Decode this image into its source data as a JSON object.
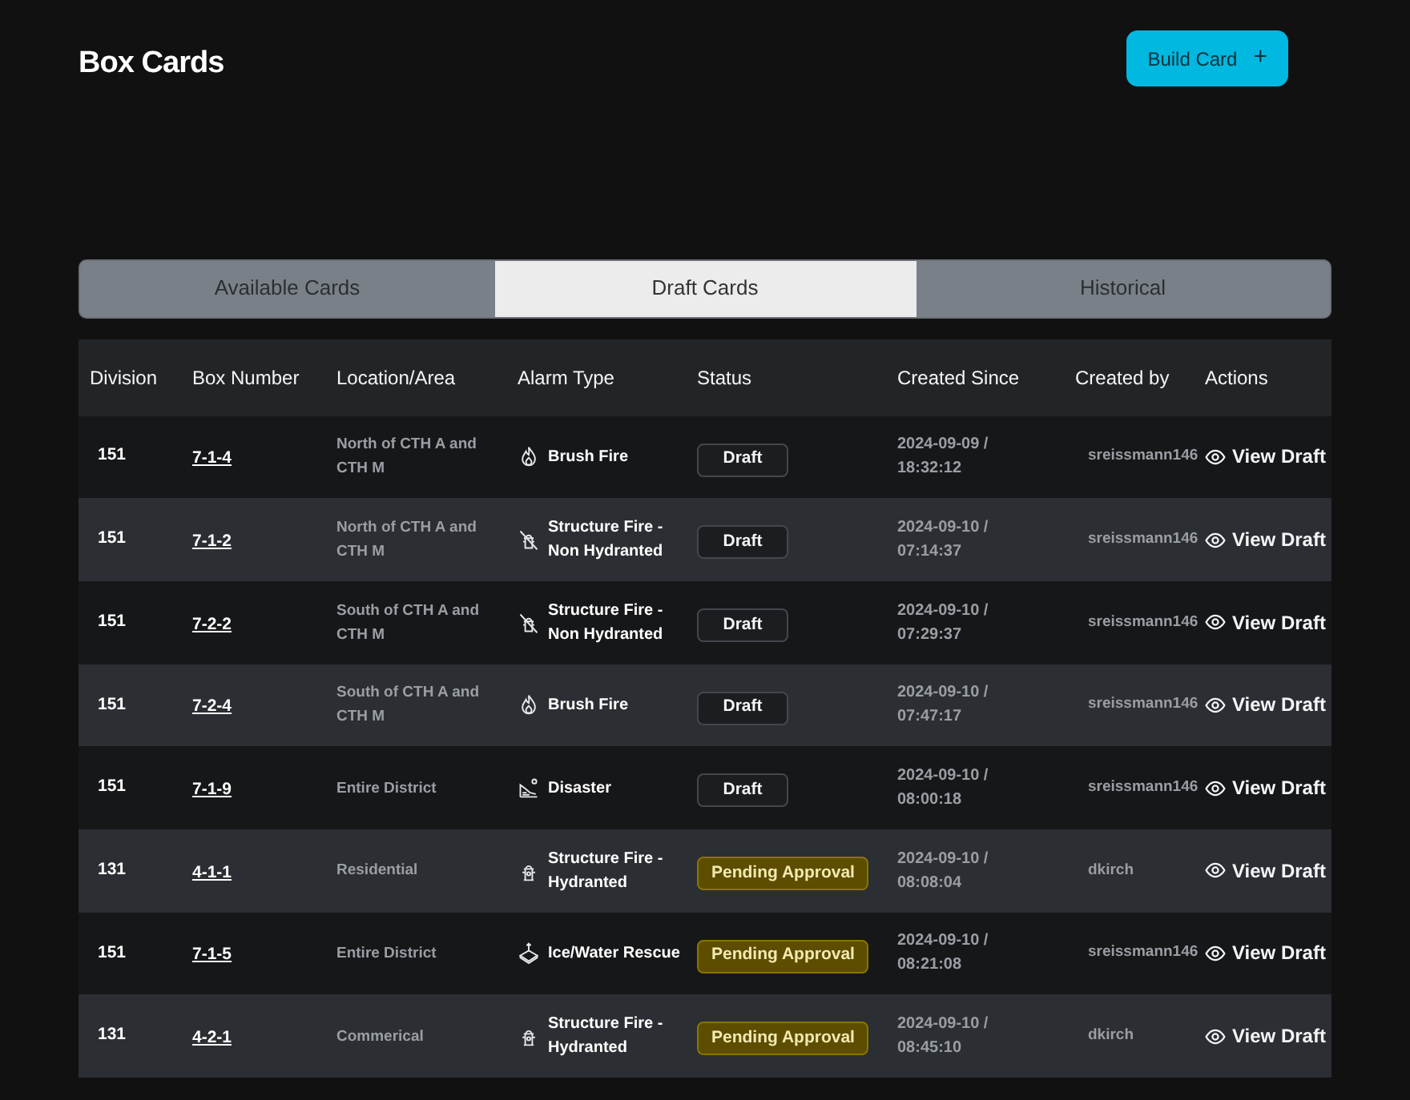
{
  "page": {
    "title": "Box Cards",
    "build_button": "Build Card",
    "build_icon": "+"
  },
  "tabs": [
    {
      "label": "Available Cards",
      "selected": false
    },
    {
      "label": "Draft Cards",
      "selected": true
    },
    {
      "label": "Historical",
      "selected": false
    }
  ],
  "table": {
    "columns": [
      "Division",
      "Box Number",
      "Location/Area",
      "Alarm Type",
      "Status",
      "Created Since",
      "Created by",
      "Actions"
    ],
    "rows": [
      {
        "division": "151",
        "box_number": "7-1-4",
        "location": "North of CTH A and CTH M",
        "alarm": {
          "kind": "brush",
          "label": "Brush Fire"
        },
        "status": {
          "kind": "draft",
          "label": "Draft"
        },
        "created_since": "2024-09-09 / 18:32:12",
        "created_by": "sreissmann146",
        "action": "View Draft"
      },
      {
        "division": "151",
        "box_number": "7-1-2",
        "location": "North of CTH A and CTH M",
        "alarm": {
          "kind": "nohydrant",
          "label": "Structure Fire - Non Hydranted"
        },
        "status": {
          "kind": "draft",
          "label": "Draft"
        },
        "created_since": "2024-09-10 / 07:14:37",
        "created_by": "sreissmann146",
        "action": "View Draft"
      },
      {
        "division": "151",
        "box_number": "7-2-2",
        "location": "South of CTH A and CTH M",
        "alarm": {
          "kind": "nohydrant",
          "label": "Structure Fire - Non Hydranted"
        },
        "status": {
          "kind": "draft",
          "label": "Draft"
        },
        "created_since": "2024-09-10 / 07:29:37",
        "created_by": "sreissmann146",
        "action": "View Draft"
      },
      {
        "division": "151",
        "box_number": "7-2-4",
        "location": "South of CTH A and CTH M",
        "alarm": {
          "kind": "brush",
          "label": "Brush Fire"
        },
        "status": {
          "kind": "draft",
          "label": "Draft"
        },
        "created_since": "2024-09-10 / 07:47:17",
        "created_by": "sreissmann146",
        "action": "View Draft"
      },
      {
        "division": "151",
        "box_number": "7-1-9",
        "location": "Entire District",
        "alarm": {
          "kind": "disaster",
          "label": "Disaster"
        },
        "status": {
          "kind": "draft",
          "label": "Draft"
        },
        "created_since": "2024-09-10 / 08:00:18",
        "created_by": "sreissmann146",
        "action": "View Draft"
      },
      {
        "division": "131",
        "box_number": "4-1-1",
        "location": "Residential",
        "alarm": {
          "kind": "hydrant",
          "label": "Structure Fire - Hydranted"
        },
        "status": {
          "kind": "pending",
          "label": "Pending Approval"
        },
        "created_since": "2024-09-10 / 08:08:04",
        "created_by": "dkirch",
        "action": "View Draft"
      },
      {
        "division": "151",
        "box_number": "7-1-5",
        "location": "Entire District",
        "alarm": {
          "kind": "rescue",
          "label": "Ice/Water Rescue"
        },
        "status": {
          "kind": "pending",
          "label": "Pending Approval"
        },
        "created_since": "2024-09-10 / 08:21:08",
        "created_by": "sreissmann146",
        "action": "View Draft"
      },
      {
        "division": "131",
        "box_number": "4-2-1",
        "location": "Commerical",
        "alarm": {
          "kind": "hydrant",
          "label": "Structure Fire - Hydranted"
        },
        "status": {
          "kind": "pending",
          "label": "Pending Approval"
        },
        "created_since": "2024-09-10 / 08:45:10",
        "created_by": "dkirch",
        "action": "View Draft"
      }
    ]
  }
}
